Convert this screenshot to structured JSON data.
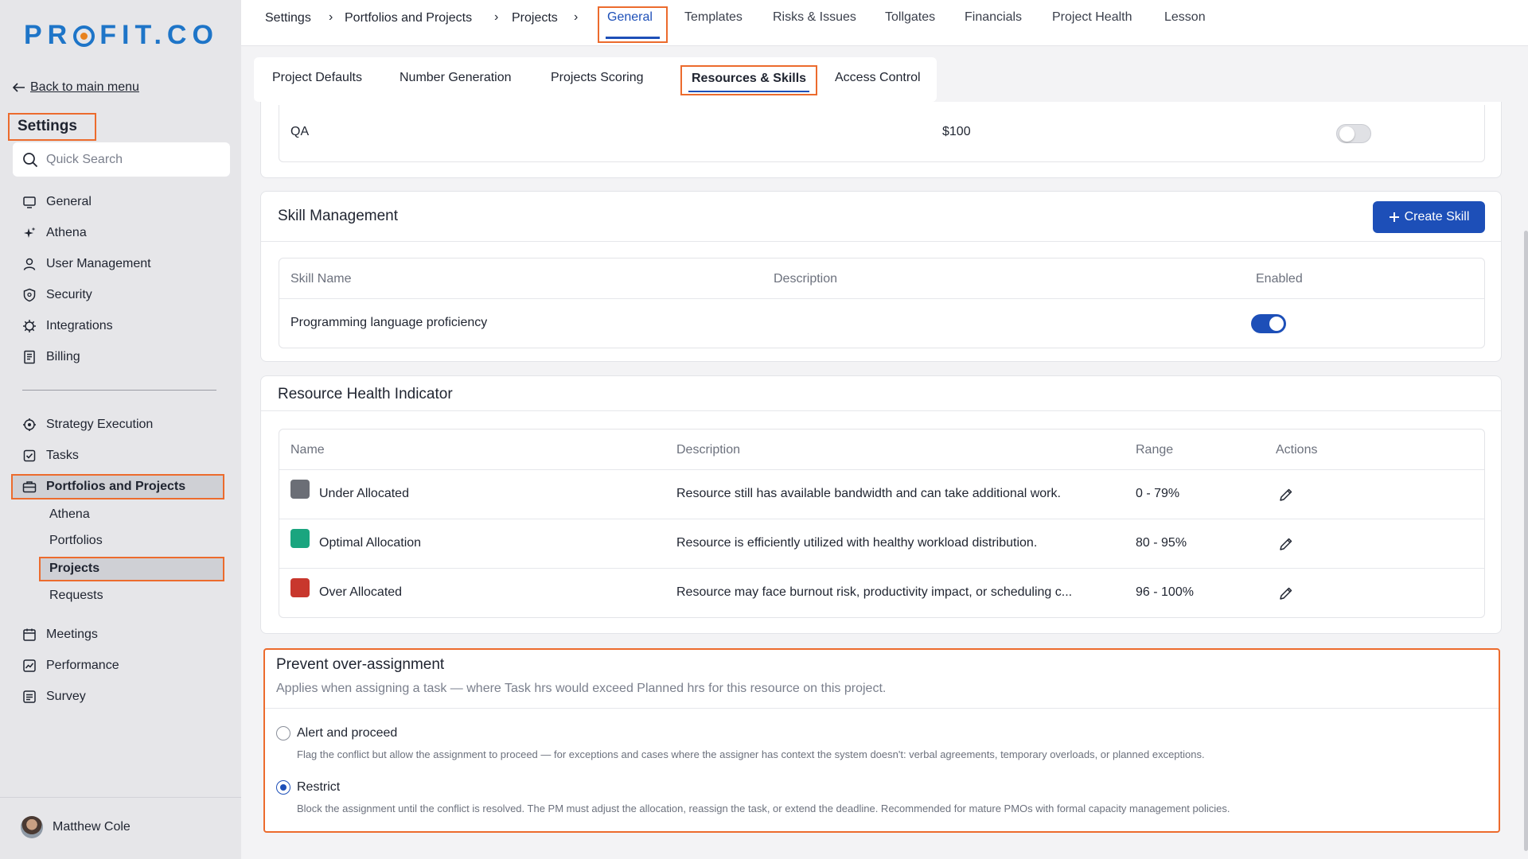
{
  "app": {
    "logo_text_left": "PR",
    "logo_text_right": "FIT.CO"
  },
  "sidebar": {
    "back_label": "Back to main menu",
    "title": "Settings",
    "search_placeholder": "Quick Search",
    "items": [
      {
        "label": "General",
        "icon": "monitor-icon"
      },
      {
        "label": "Athena",
        "icon": "sparkle-icon"
      },
      {
        "label": "User Management",
        "icon": "user-icon"
      },
      {
        "label": "Security",
        "icon": "shield-icon"
      },
      {
        "label": "Integrations",
        "icon": "gear-icon"
      },
      {
        "label": "Billing",
        "icon": "receipt-icon"
      }
    ],
    "modules": [
      {
        "label": "Strategy Execution",
        "icon": "target-icon"
      },
      {
        "label": "Tasks",
        "icon": "checkbox-icon"
      },
      {
        "label": "Portfolios and Projects",
        "icon": "briefcase-icon"
      }
    ],
    "sub_items": [
      "Athena",
      "Portfolios",
      "Projects",
      "Requests"
    ],
    "more_modules": [
      {
        "label": "Meetings",
        "icon": "calendar-icon"
      },
      {
        "label": "Performance",
        "icon": "chart-icon"
      },
      {
        "label": "Survey",
        "icon": "survey-icon"
      }
    ],
    "user_name": "Matthew Cole"
  },
  "breadcrumb": [
    "Settings",
    "Portfolios and Projects",
    "Projects"
  ],
  "breadcrumb_sep": "›",
  "top_tabs": [
    "General",
    "Templates",
    "Risks & Issues",
    "Tollgates",
    "Financials",
    "Project Health",
    "Lesson"
  ],
  "sub_tabs": [
    "Project Defaults",
    "Number Generation",
    "Projects Scoring",
    "Resources & Skills",
    "Access Control"
  ],
  "role_row": {
    "name": "QA",
    "rate": "$100",
    "enabled": false
  },
  "skill_management": {
    "title": "Skill Management",
    "create_label": "Create Skill",
    "headers": [
      "Skill Name",
      "Description",
      "Enabled"
    ],
    "rows": [
      {
        "name": "Programming language proficiency",
        "description": "",
        "enabled": true
      }
    ]
  },
  "resource_health": {
    "title": "Resource Health Indicator",
    "headers": [
      "Name",
      "Description",
      "Range",
      "Actions"
    ],
    "rows": [
      {
        "name": "Under Allocated",
        "color": "#6b6e76",
        "description": "Resource still has available bandwidth and can take additional work.",
        "range": "0 - 79%"
      },
      {
        "name": "Optimal Allocation",
        "color": "#1aa57f",
        "description": "Resource is efficiently utilized with healthy workload distribution.",
        "range": "80 - 95%"
      },
      {
        "name": "Over Allocated",
        "color": "#c8372d",
        "description": "Resource may face burnout risk, productivity impact, or scheduling c...",
        "range": "96 - 100%"
      }
    ]
  },
  "prevent": {
    "title": "Prevent over-assignment",
    "subtitle": "Applies when assigning a task — where Task hrs would exceed Planned hrs for this resource on this project.",
    "options": [
      {
        "label": "Alert and proceed",
        "description": "Flag the conflict but allow the assignment to proceed — for exceptions and cases where the assigner has context the system doesn't: verbal agreements, temporary overloads, or planned exceptions.",
        "selected": false
      },
      {
        "label": "Restrict",
        "description": "Block the assignment until the conflict is resolved. The PM must adjust the allocation, reassign the task, or extend the deadline. Recommended for mature PMOs with formal capacity management policies.",
        "selected": true
      }
    ]
  },
  "colors": {
    "accent": "#1d4fb8",
    "highlight": "#ec6b2d",
    "brand": "#1e75c8"
  }
}
